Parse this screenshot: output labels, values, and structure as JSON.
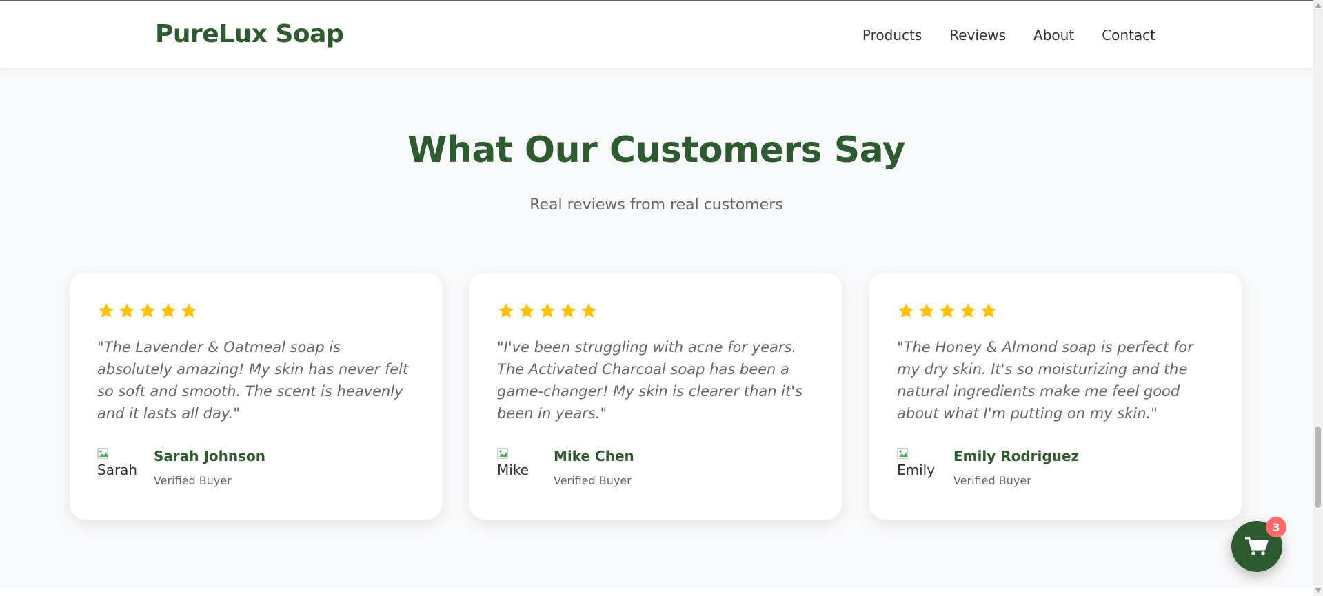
{
  "brand": {
    "name": "PureLux Soap"
  },
  "nav": {
    "items": [
      {
        "label": "Products"
      },
      {
        "label": "Reviews"
      },
      {
        "label": "About"
      },
      {
        "label": "Contact"
      }
    ]
  },
  "section": {
    "title": "What Our Customers Say",
    "subtitle": "Real reviews from real customers"
  },
  "colors": {
    "primary": "#2d5a2e",
    "star": "#ffc107",
    "badge": "#ff6b6b"
  },
  "reviews": [
    {
      "rating": 5,
      "quote": "\"The Lavender & Oatmeal soap is absolutely amazing! My skin has never felt so soft and smooth. The scent is heavenly and it lasts all day.\"",
      "avatar_alt": "Sarah",
      "name": "Sarah Johnson",
      "role": "Verified Buyer"
    },
    {
      "rating": 5,
      "quote": "\"I've been struggling with acne for years. The Activated Charcoal soap has been a game-changer! My skin is clearer than it's been in years.\"",
      "avatar_alt": "Mike",
      "name": "Mike Chen",
      "role": "Verified Buyer"
    },
    {
      "rating": 5,
      "quote": "\"The Honey & Almond soap is perfect for my dry skin. It's so moisturizing and the natural ingredients make me feel good about what I'm putting on my skin.\"",
      "avatar_alt": "Emily",
      "name": "Emily Rodriguez",
      "role": "Verified Buyer"
    }
  ],
  "cart": {
    "count": "3",
    "icon": "cart-icon"
  }
}
